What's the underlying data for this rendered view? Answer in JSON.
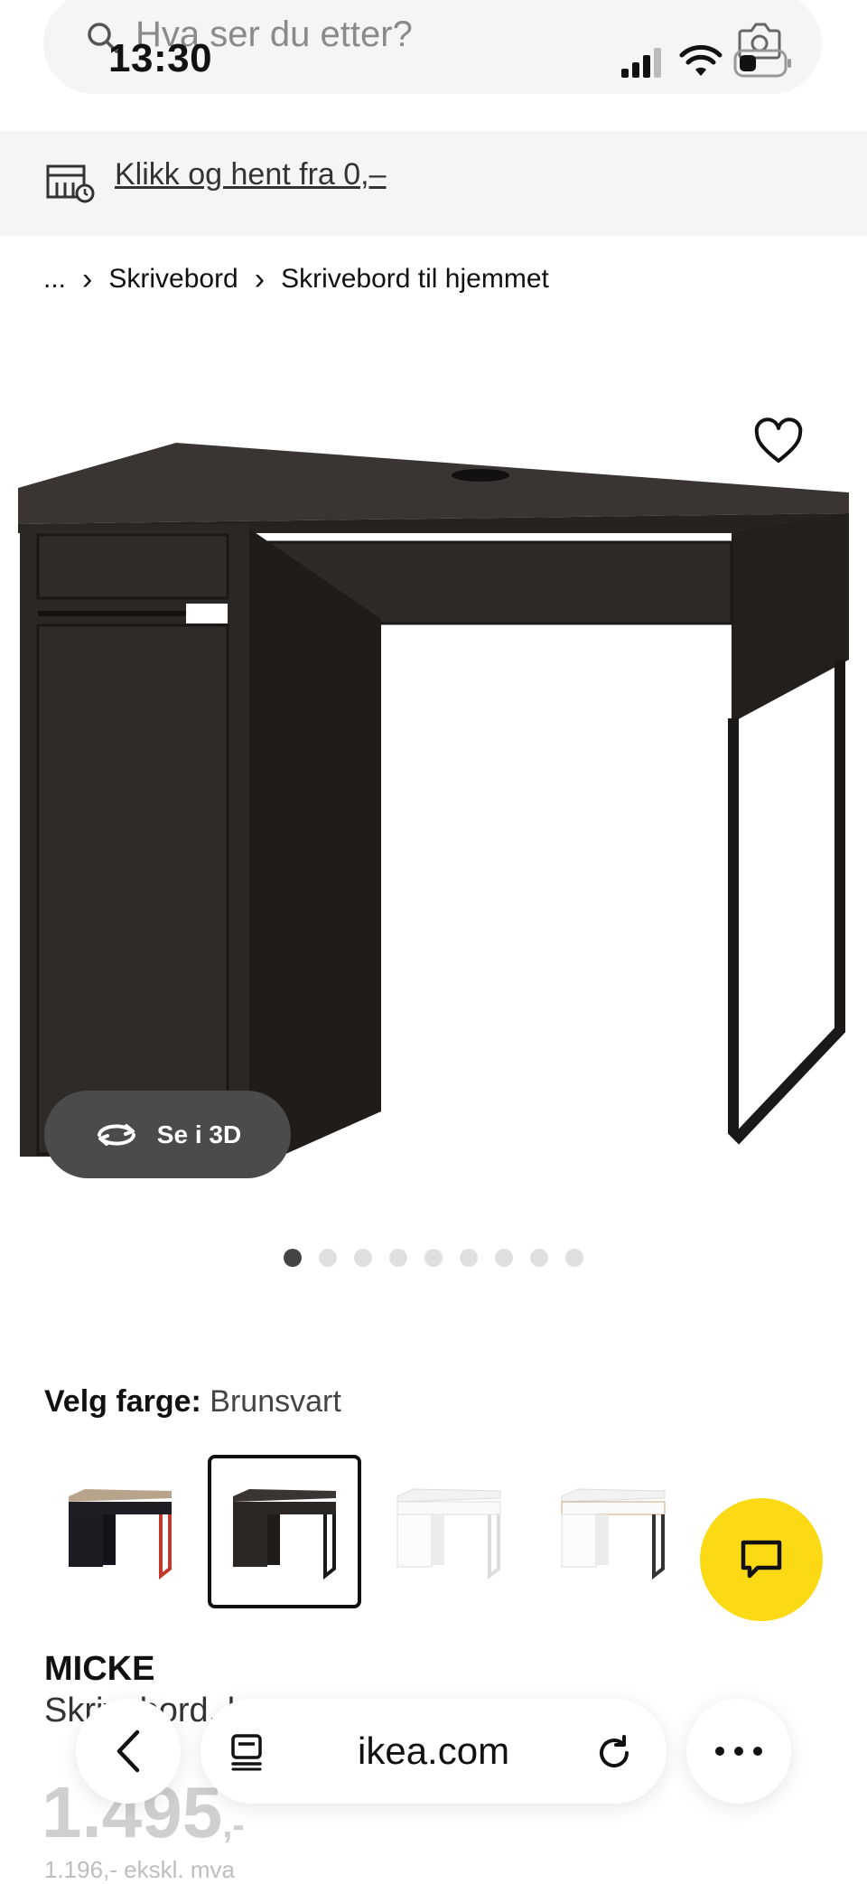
{
  "status_bar": {
    "time": "13:30"
  },
  "search": {
    "placeholder": "Hva ser du etter?"
  },
  "promo": {
    "text": "Klikk og hent fra 0,–"
  },
  "breadcrumb": {
    "items": [
      "...",
      "Skrivebord",
      "Skrivebord til hjemmet"
    ]
  },
  "gallery": {
    "view_3d_label": "Se i 3D",
    "image_count": 9,
    "active_index": 0
  },
  "color": {
    "label": "Velg farge:",
    "value": "Brunsvart",
    "swatches": [
      {
        "name": "svart/rød"
      },
      {
        "name": "Brunsvart",
        "selected": true
      },
      {
        "name": "hvit"
      },
      {
        "name": "hvit/eik"
      }
    ]
  },
  "product": {
    "name": "MICKE",
    "description": "Skrivebord, b",
    "price": "1.495",
    "price_suffix": ",-",
    "price_ex_vat": "1.196,- ekskl. mva"
  },
  "browser": {
    "url": "ikea.com"
  },
  "colors": {
    "accent_yellow": "#fbd914",
    "button_dark": "#4b4b4b",
    "desk_brown_black": "#2b2724"
  }
}
